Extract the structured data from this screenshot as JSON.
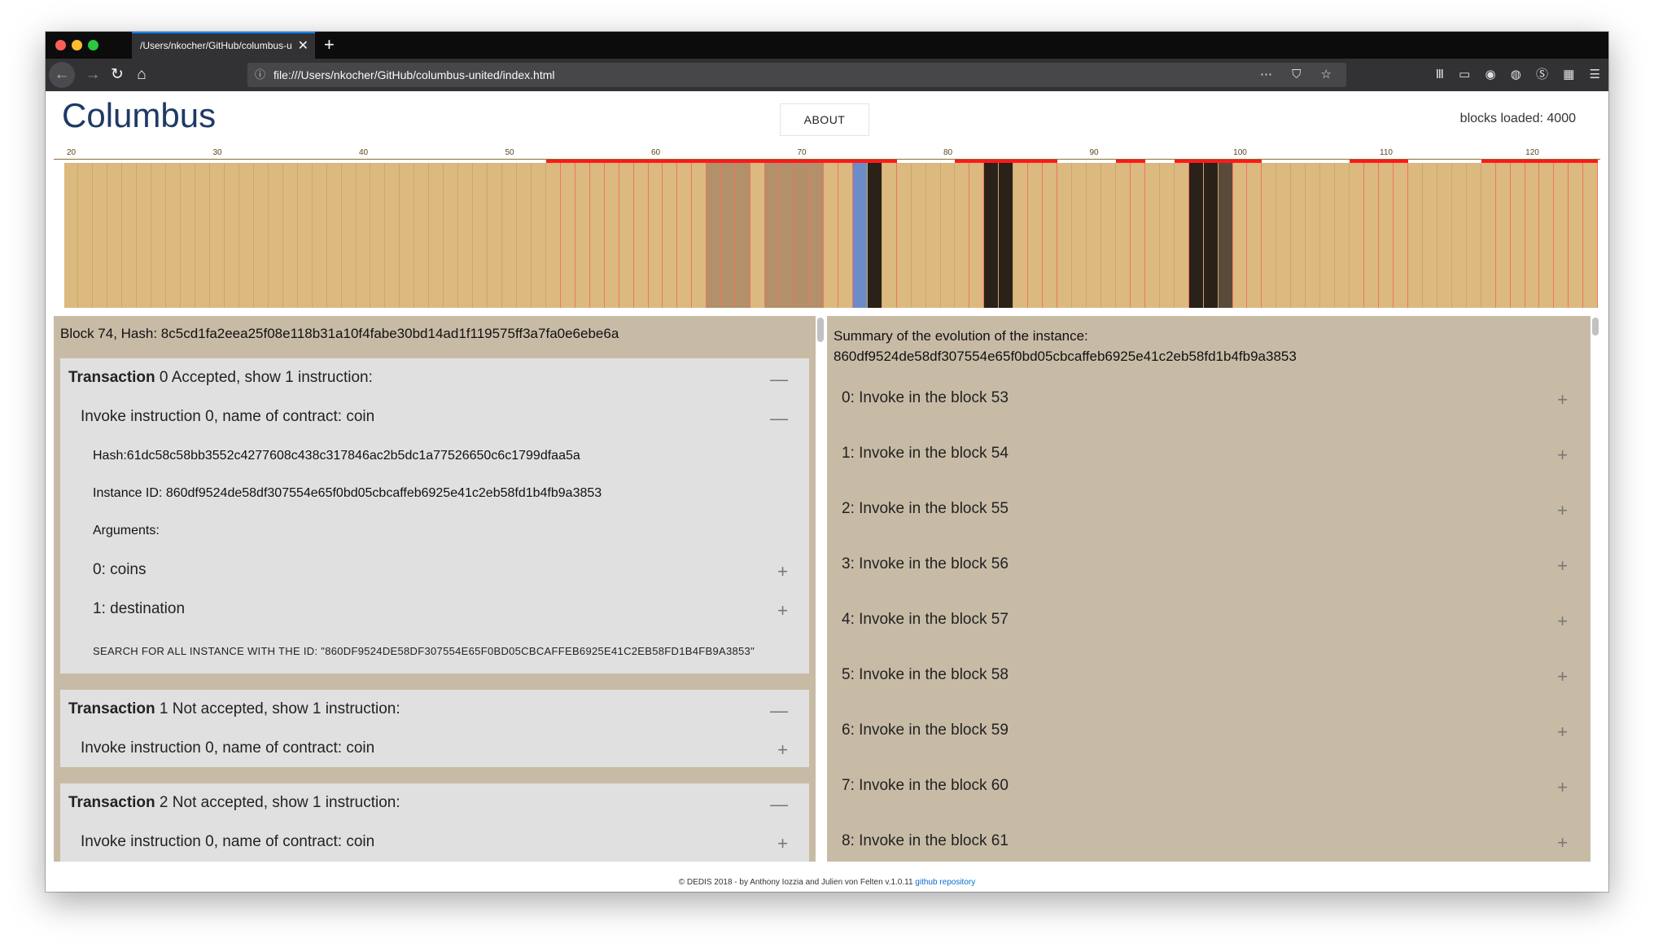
{
  "browser": {
    "tab_title": "/Users/nkocher/GitHub/columbus-u",
    "url": "file:///Users/nkocher/GitHub/columbus-united/index.html"
  },
  "header": {
    "logo": "Columbus",
    "about_label": "ABOUT",
    "blocks_loaded": "blocks loaded: 4000"
  },
  "timeline": {
    "tick_labels": [
      "20",
      "30",
      "40",
      "50",
      "60",
      "70",
      "80",
      "90",
      "100",
      "110",
      "120"
    ],
    "colors": {
      "block": "#dbb97f",
      "block_line": "#c9a76f",
      "highlight_line": "#f07560",
      "dark_block": "#2a2119",
      "selected_block": "#6b8cc7",
      "muted_block": "#b1906a",
      "red_bar": "#ff1a1a"
    }
  },
  "block_panel": {
    "title": "Block 74, Hash: 8c5cd1fa2eea25f08e118b31a10f4fabe30bd14ad1f119575ff3a7fa0e6ebe6a",
    "transactions": [
      {
        "label_bold": "Transaction",
        "label_rest": " 0 Accepted, show 1 instruction:",
        "instruction": "Invoke instruction 0, name of contract: coin",
        "hash": "Hash:61dc58c58bb3552c4277608c438c317846ac2b5dc1a77526650c6c1799dfaa5a",
        "instance_id": "Instance ID: 860df9524de58df307554e65f0bd05cbcaffeb6925e41c2eb58fd1b4fb9a3853",
        "arguments_label": "Arguments:",
        "args": [
          "0: coins",
          "1: destination"
        ],
        "search": "SEARCH FOR ALL INSTANCE WITH THE ID: \"860DF9524DE58DF307554E65F0BD05CBCAFFEB6925E41C2EB58FD1B4FB9A3853\""
      },
      {
        "label_bold": "Transaction",
        "label_rest": " 1 Not accepted, show 1 instruction:",
        "instruction": "Invoke instruction 0, name of contract: coin"
      },
      {
        "label_bold": "Transaction",
        "label_rest": " 2 Not accepted, show 1 instruction:",
        "instruction": "Invoke instruction 0, name of contract: coin"
      }
    ]
  },
  "summary_panel": {
    "title_line1": "Summary of the evolution of the instance:",
    "title_line2": "860df9524de58df307554e65f0bd05cbcaffeb6925e41c2eb58fd1b4fb9a3853",
    "items": [
      "0: Invoke in the block 53",
      "1: Invoke in the block 54",
      "2: Invoke in the block 55",
      "3: Invoke in the block 56",
      "4: Invoke in the block 57",
      "5: Invoke in the block 58",
      "6: Invoke in the block 59",
      "7: Invoke in the block 60",
      "8: Invoke in the block 61"
    ]
  },
  "footer": {
    "text": "© DEDIS 2018 - by Anthony Iozzia and Julien von Felten v.1.0.11 ",
    "link": "github repository"
  }
}
